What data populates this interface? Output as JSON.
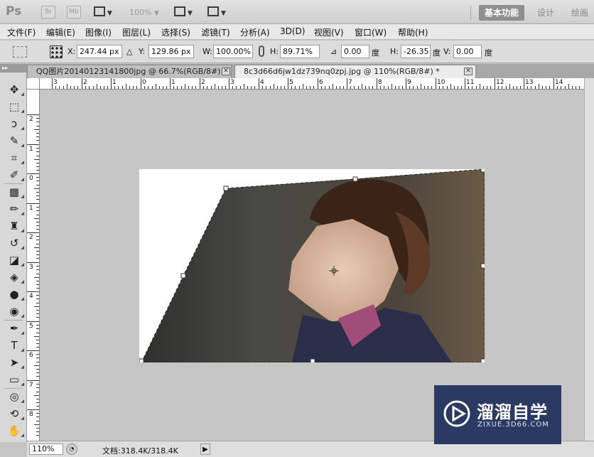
{
  "app": {
    "logo": "Ps",
    "bridge_label": "Br",
    "minibridge_label": "Mb",
    "zoom_level": "100%",
    "workspaces": [
      "基本功能",
      "设计",
      "绘画"
    ]
  },
  "menu": [
    "文件(F)",
    "编辑(E)",
    "图像(I)",
    "图层(L)",
    "选择(S)",
    "滤镜(T)",
    "分析(A)",
    "3D(D)",
    "视图(V)",
    "窗口(W)",
    "帮助(H)"
  ],
  "options": {
    "x_label": "X:",
    "x_value": "247.44 px",
    "y_label": "Y:",
    "y_value": "129.86 px",
    "w_label": "W:",
    "w_value": "100.00%",
    "h_label": "H:",
    "h_value": "89.71%",
    "angle_value": "0.00",
    "angle_unit": "度",
    "hskew_label": "H:",
    "hskew_value": "-26.35",
    "hskew_unit": "度",
    "vskew_label": "V:",
    "vskew_value": "0.00",
    "vskew_unit": "度"
  },
  "tabs": [
    {
      "label": "QQ图片20140123141800jpg @ 66.7%(RGB/8#)",
      "active": false
    },
    {
      "label": "8c3d66d6jw1dz739nq0zpj.jpg @ 110%(RGB/8#) *",
      "active": true
    }
  ],
  "ruler_h_labels": [
    "3",
    "2",
    "1",
    "0",
    "1",
    "2",
    "3",
    "4",
    "5",
    "6",
    "7",
    "8",
    "9",
    "10",
    "11",
    "12",
    "13",
    "14"
  ],
  "ruler_v_labels": [
    "2",
    "1",
    "0",
    "1",
    "2",
    "3",
    "4",
    "5",
    "6",
    "7",
    "8"
  ],
  "status": {
    "zoom": "110%",
    "doc_info": "文档:318.4K/318.4K"
  },
  "watermark": {
    "title": "溜溜自学",
    "subtitle": "ZIXUE.3D66.COM"
  },
  "colors": {
    "workspace_active": "#8f8f8f",
    "watermark_bg": "#2b3a63",
    "canvas_bg": "#c6c6c6"
  }
}
